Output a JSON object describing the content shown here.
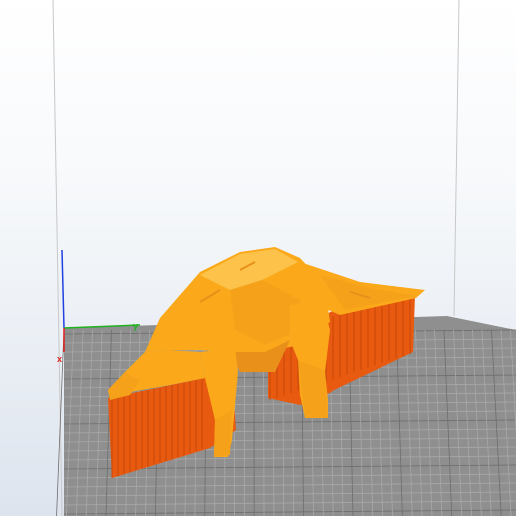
{
  "viewport": {
    "background_top": "#ffffff",
    "background_bottom": "#dde4ee"
  },
  "build_plate": {
    "color": "#8f8f8f",
    "grid_color": "#a8a8a8",
    "major_grid_color": "#6e6e6e"
  },
  "build_volume": {
    "edge_color": "#c8c8c8"
  },
  "axes": {
    "x": {
      "label": "x",
      "color": "#e02020"
    },
    "y": {
      "label": "y",
      "color": "#20b020"
    },
    "z": {
      "label": "z",
      "color": "#2040e0"
    }
  },
  "model": {
    "name": "dinosaur",
    "fill": "#fba91a",
    "shade": "#e8901a",
    "highlight": "#fcc24a"
  },
  "support": {
    "color": "#e85a0f",
    "shade": "#c8480a"
  }
}
